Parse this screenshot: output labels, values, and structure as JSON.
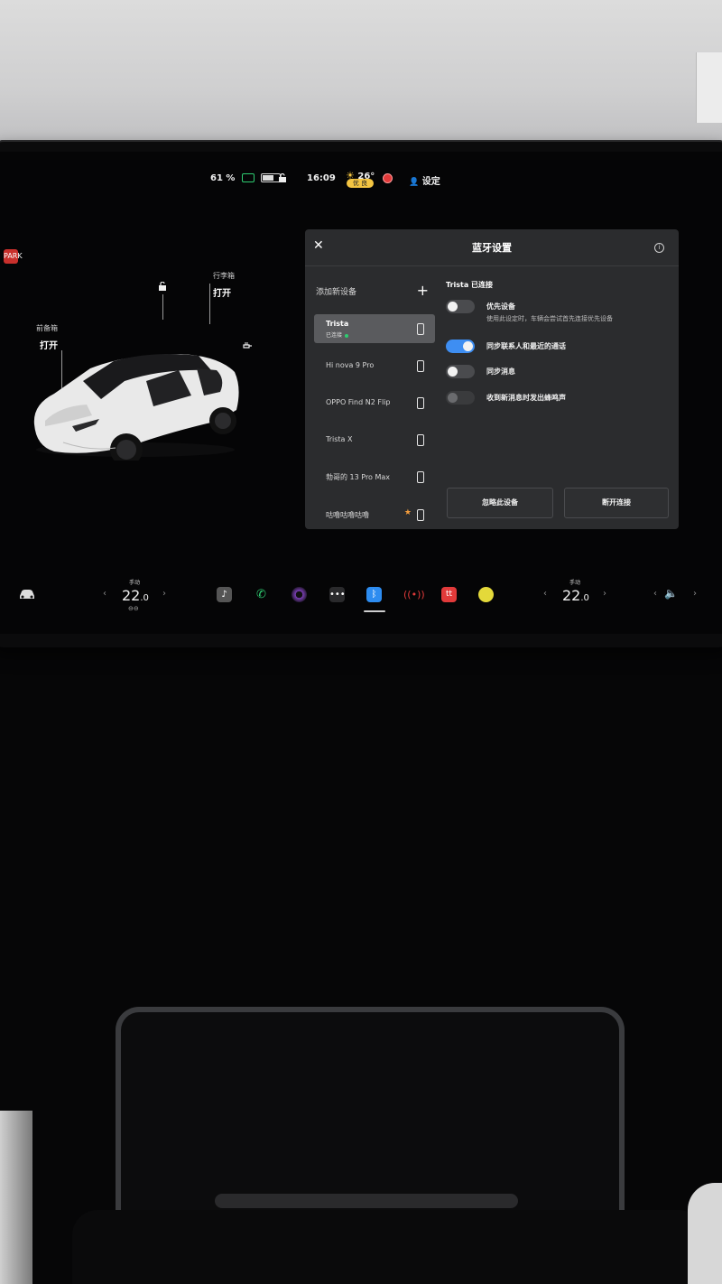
{
  "status_bar": {
    "battery": "61 %",
    "time": "16:09",
    "temperature": "26°",
    "aqi": "优 良",
    "profile": "设定"
  },
  "car_panel": {
    "frunk_label": "前备箱",
    "frunk_action": "打开",
    "trunk_label": "行李箱",
    "trunk_action": "打开",
    "park_badge": "PARK"
  },
  "bluetooth": {
    "title": "蓝牙设置",
    "add_device": "添加新设备",
    "devices": [
      {
        "name": "Trista",
        "status": "已连接",
        "selected": true
      },
      {
        "name": "Hi nova 9 Pro"
      },
      {
        "name": "OPPO Find N2 Flip"
      },
      {
        "name": "Trista X"
      },
      {
        "name": "勃哥的 13 Pro Max"
      },
      {
        "name": "咕噜咕噜咕噜",
        "favorite": true
      }
    ],
    "detail_title": "Trista 已连接",
    "options": [
      {
        "label": "优先设备",
        "desc": "使用此设定时，车辆会尝试首先连接优先设备",
        "state": "off"
      },
      {
        "label": "同步联系人和最近的通话",
        "state": "on"
      },
      {
        "label": "同步消息",
        "state": "off"
      },
      {
        "label": "收到新消息时发出蜂鸣声",
        "state": "disabled"
      }
    ],
    "forget_button": "忽略此设备",
    "disconnect_button": "断开连接"
  },
  "dock": {
    "left_temp_mode": "手动",
    "left_temp_int": "22",
    "left_temp_dec": ".0",
    "right_temp_mode": "手动",
    "right_temp_int": "22",
    "right_temp_dec": ".0"
  }
}
